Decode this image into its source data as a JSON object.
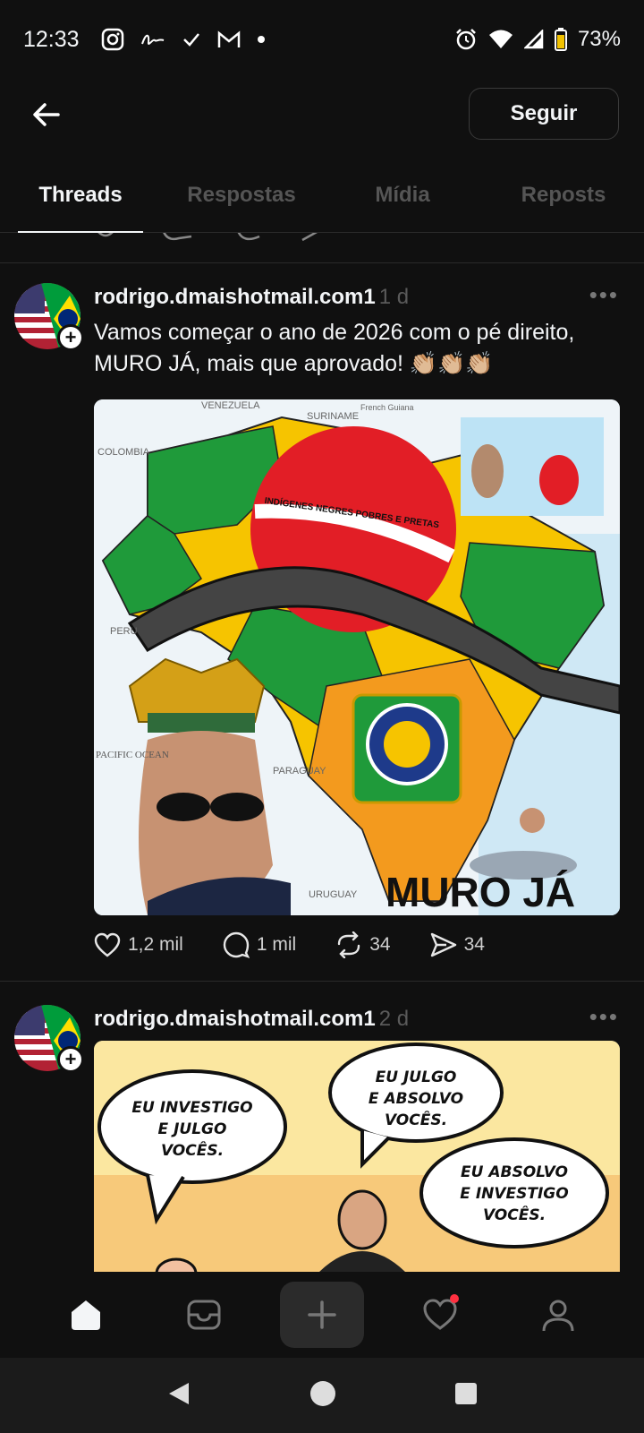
{
  "status_bar": {
    "time": "12:33",
    "battery": "73%",
    "notification_icons": [
      "instagram-icon",
      "signature-icon",
      "check-icon",
      "gmail-icon",
      "dot-icon"
    ],
    "system_icons": [
      "alarm-icon",
      "wifi-icon",
      "signal-icon",
      "battery-icon"
    ]
  },
  "header": {
    "follow_label": "Seguir"
  },
  "tabs": [
    {
      "label": "Threads",
      "active": true
    },
    {
      "label": "Respostas",
      "active": false
    },
    {
      "label": "Mídia",
      "active": false
    },
    {
      "label": "Reposts",
      "active": false
    }
  ],
  "posts": [
    {
      "username": "rodrigo.dmaishotmail.com1",
      "ago": "1 d",
      "text_line1": "Vamos começar o ano de 2026 com o pé direito,",
      "text_line2": "MURO JÁ, mais que aprovado! 👏🏼👏🏼👏🏼",
      "image": {
        "map_labels": [
          "VENEZUELA",
          "SURINAME",
          "French Guiana",
          "COLOMBIA",
          "PERU",
          "PACIFIC OCEAN",
          "PARAGUAY",
          "URUGUAY"
        ],
        "banner_text": "INDÍGENES NEGRES POBRES E PRETAS",
        "caption": "MURO JÁ"
      },
      "likes": "1,2 mil",
      "replies": "1 mil",
      "reposts": "34",
      "shares": "34"
    },
    {
      "username": "rodrigo.dmaishotmail.com1",
      "ago": "2 d",
      "image": {
        "bubble1": "EU INVESTIGO E JULGO VOCÊS.",
        "bubble2": "EU JULGO E ABSOLVO VOCÊS.",
        "bubble3": "EU ABSOLVO E INVESTIGO VOCÊS."
      }
    }
  ],
  "bottom_nav": [
    "home-icon",
    "inbox-icon",
    "create-icon",
    "activity-icon",
    "profile-icon"
  ],
  "colors": {
    "background": "#101010",
    "text": "#f3f5f7",
    "muted": "#5a5a5a",
    "notification_dot": "#ff3040"
  }
}
